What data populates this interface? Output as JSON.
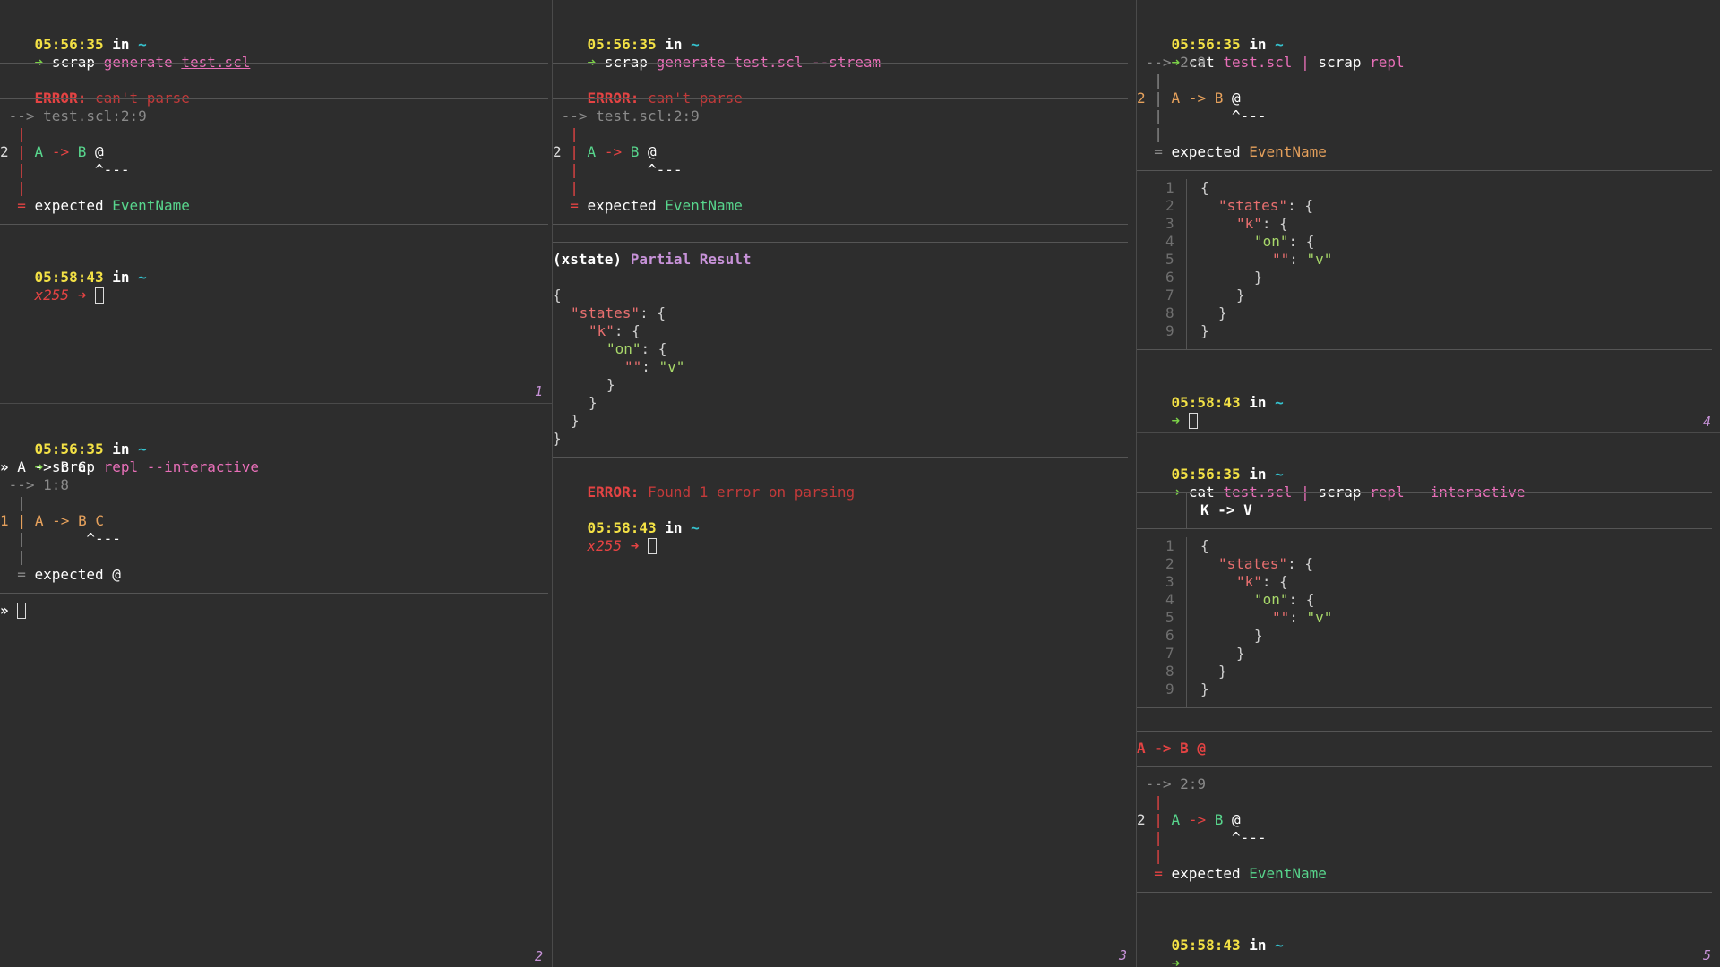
{
  "pane1": {
    "time1": "05:56:35",
    "in": "in",
    "tilde": "~",
    "prompt_arrow": "➜",
    "cmd": "scrap",
    "sub": "generate",
    "file": "test.scl",
    "error_label": "ERROR:",
    "error_msg": "can't parse",
    "loc": " --> test.scl:2:9",
    "bar": "  |",
    "src_num": "2",
    "src_bar": " | ",
    "src_a": "A",
    "src_arrow": " -> ",
    "src_b": "B",
    "src_at": " @",
    "caret": "           ^---",
    "expected_pre": "  = ",
    "expected_text": "expected ",
    "expected_name": "EventName",
    "time2": "05:58:43",
    "exit_code": "x255",
    "exit_arrow": " ➜ ",
    "number": "1"
  },
  "pane2": {
    "time1": "05:56:35",
    "in": "in",
    "tilde": "~",
    "prompt_arrow": "➜",
    "cmd": "scrap",
    "sub": "repl",
    "flag": "--interactive",
    "repl_prompt": "»",
    "repl_input": " A -> B C",
    "loc": " --> 1:8",
    "bar": "  |",
    "src_num": "1",
    "src_line": " | A -> B C",
    "caret": "          ^---",
    "expected_pre": "  = ",
    "expected_text": "expected @",
    "number": "2"
  },
  "pane3": {
    "time1": "05:56:35",
    "in": "in",
    "tilde": "~",
    "prompt_arrow": "➜",
    "cmd": "scrap",
    "sub": "generate",
    "file": "test.scl",
    "flag": "--stream",
    "error_label": "ERROR:",
    "error_msg": "can't parse",
    "loc": " --> test.scl:2:9",
    "bar": "  |",
    "src_num": "2",
    "src_bar": " | ",
    "src_a": "A",
    "src_arrow": " -> ",
    "src_b": "B",
    "src_at": " @",
    "caret": "           ^---",
    "expected_pre": "  = ",
    "expected_text": "expected ",
    "expected_name": "EventName",
    "xstate": "(xstate)",
    "partial": "Partial Result",
    "json_open": "{",
    "json_states": "\"states\"",
    "json_k": "\"k\"",
    "json_on": "\"on\"",
    "json_empty": "\"\"",
    "json_v": "\"v\"",
    "colon_brace": ": {",
    "colon": ": ",
    "close": "}",
    "error2_label": "ERROR:",
    "error2_msg": "Found 1 error on parsing",
    "time2": "05:58:43",
    "exit_code": "x255",
    "exit_arrow": " ➜ ",
    "number": "3"
  },
  "pane4": {
    "time1": "05:56:35",
    "in": "in",
    "tilde": "~",
    "prompt_arrow": "➜",
    "cmd_cat": "cat",
    "file": "test.scl",
    "pipe": "|",
    "cmd": "scrap",
    "sub": "repl",
    "loc": " --> 2:9",
    "bar": "  |",
    "src_num": "2",
    "src_bar": " | ",
    "src_a": "A",
    "src_arrow": " -> ",
    "src_b": "B",
    "src_at": " @",
    "caret": "           ^---",
    "expected_pre": "  = ",
    "expected_text": "expected ",
    "expected_name": "EventName",
    "line_numbers": [
      "1",
      "2",
      "3",
      "4",
      "5",
      "6",
      "7",
      "8",
      "9"
    ],
    "time2": "05:58:43",
    "number": "4"
  },
  "pane5": {
    "time1": "05:56:35",
    "in": "in",
    "tilde": "~",
    "prompt_arrow": "➜",
    "cmd_cat": "cat",
    "file": "test.scl",
    "pipe": "|",
    "cmd": "scrap",
    "sub": "repl",
    "flag": "--interactive",
    "input": "K -> V",
    "line_numbers": [
      "1",
      "2",
      "3",
      "4",
      "5",
      "6",
      "7",
      "8",
      "9"
    ],
    "err_input": "A -> B @",
    "loc": " --> 2:9",
    "bar": "  |",
    "src_num": "2",
    "src_bar": " | ",
    "src_a": "A",
    "src_arrow": " -> ",
    "src_b": "B",
    "src_at": " @",
    "caret": "           ^---",
    "expected_pre": "  = ",
    "expected_text": "expected ",
    "expected_name": "EventName",
    "time2": "05:58:43",
    "number": "5"
  }
}
